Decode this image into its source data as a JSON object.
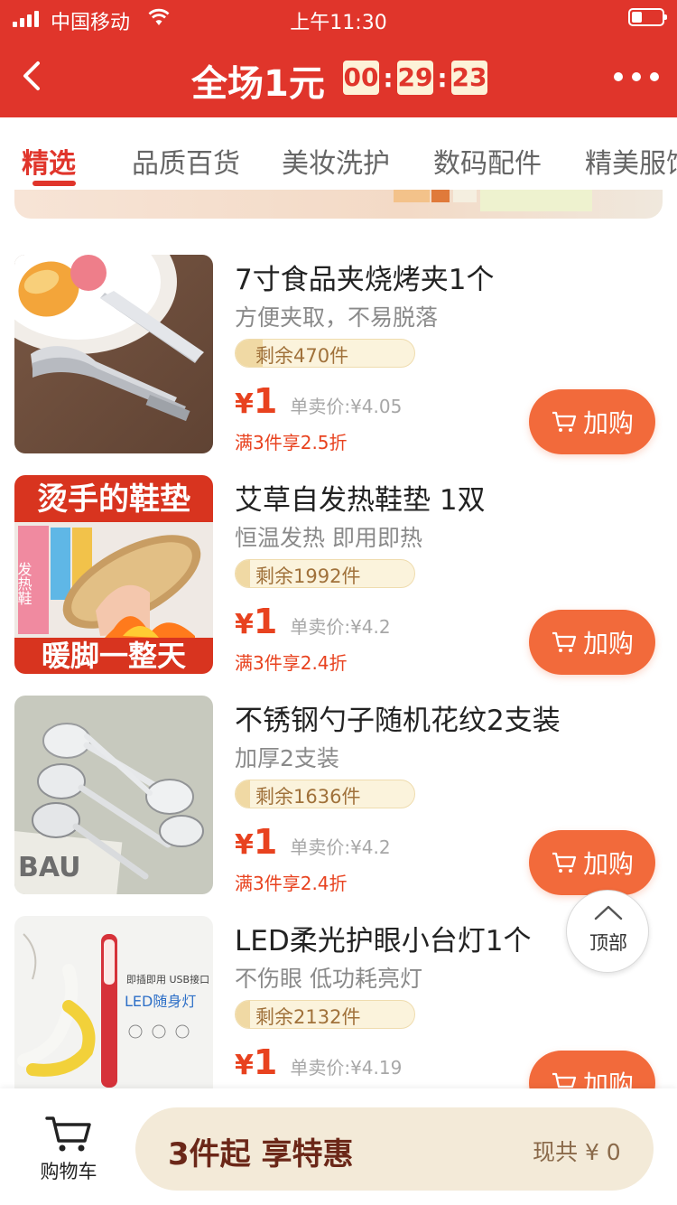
{
  "status_bar": {
    "carrier": "中国移动",
    "time": "上午11:30"
  },
  "header": {
    "title": "全场1元",
    "countdown": {
      "hours": "00",
      "minutes": "29",
      "seconds": "23"
    }
  },
  "tabs": [
    {
      "label": "精选",
      "active": true
    },
    {
      "label": "品质百货",
      "active": false
    },
    {
      "label": "美妆洗护",
      "active": false
    },
    {
      "label": "数码配件",
      "active": false
    },
    {
      "label": "精美服饰",
      "active": false
    }
  ],
  "products": [
    {
      "title": "7寸食品夹烧烤夹1个",
      "subtitle": "方便夹取，不易脱落",
      "stock": "剩余470件",
      "stock_fill": 0.15,
      "price_symbol": "¥",
      "price": "1",
      "single_label": "单卖价:",
      "single_price": "¥4.05",
      "promo": "满3件享2.5折",
      "add_label": "加购"
    },
    {
      "title": "艾草自发热鞋垫 1双",
      "subtitle": "恒温发热 即用即热",
      "stock": "剩余1992件",
      "stock_fill": 0.08,
      "price_symbol": "¥",
      "price": "1",
      "single_label": "单卖价:",
      "single_price": "¥4.2",
      "promo": "满3件享2.4折",
      "add_label": "加购",
      "image_text_top": "烫手的鞋垫",
      "image_text_bottom": "暖脚一整天",
      "image_text_pack": "发热鞋"
    },
    {
      "title": "不锈钢勺子随机花纹2支装",
      "subtitle": "加厚2支装",
      "stock": "剩余1636件",
      "stock_fill": 0.08,
      "price_symbol": "¥",
      "price": "1",
      "single_label": "单卖价:",
      "single_price": "¥4.2",
      "promo": "满3件享2.4折",
      "add_label": "加购",
      "image_text": "BAU"
    },
    {
      "title": "LED柔光护眼小台灯1个",
      "subtitle": "不伤眼 低功耗亮灯",
      "stock": "剩余2132件",
      "stock_fill": 0.08,
      "price_symbol": "¥",
      "price": "1",
      "single_label": "单卖价:",
      "single_price": "¥4.19",
      "promo": "",
      "add_label": "加购",
      "image_text_line1": "即插即用 USB接口",
      "image_text_line2": "LED随身灯"
    }
  ],
  "top_button": {
    "label": "顶部"
  },
  "bottom_bar": {
    "cart_label": "购物车",
    "cta": "3件起 享特惠",
    "total": "现共 ¥ 0"
  },
  "colors": {
    "brand_red": "#e0352b",
    "accent_orange": "#f26a3b",
    "price_red": "#e8421f"
  }
}
